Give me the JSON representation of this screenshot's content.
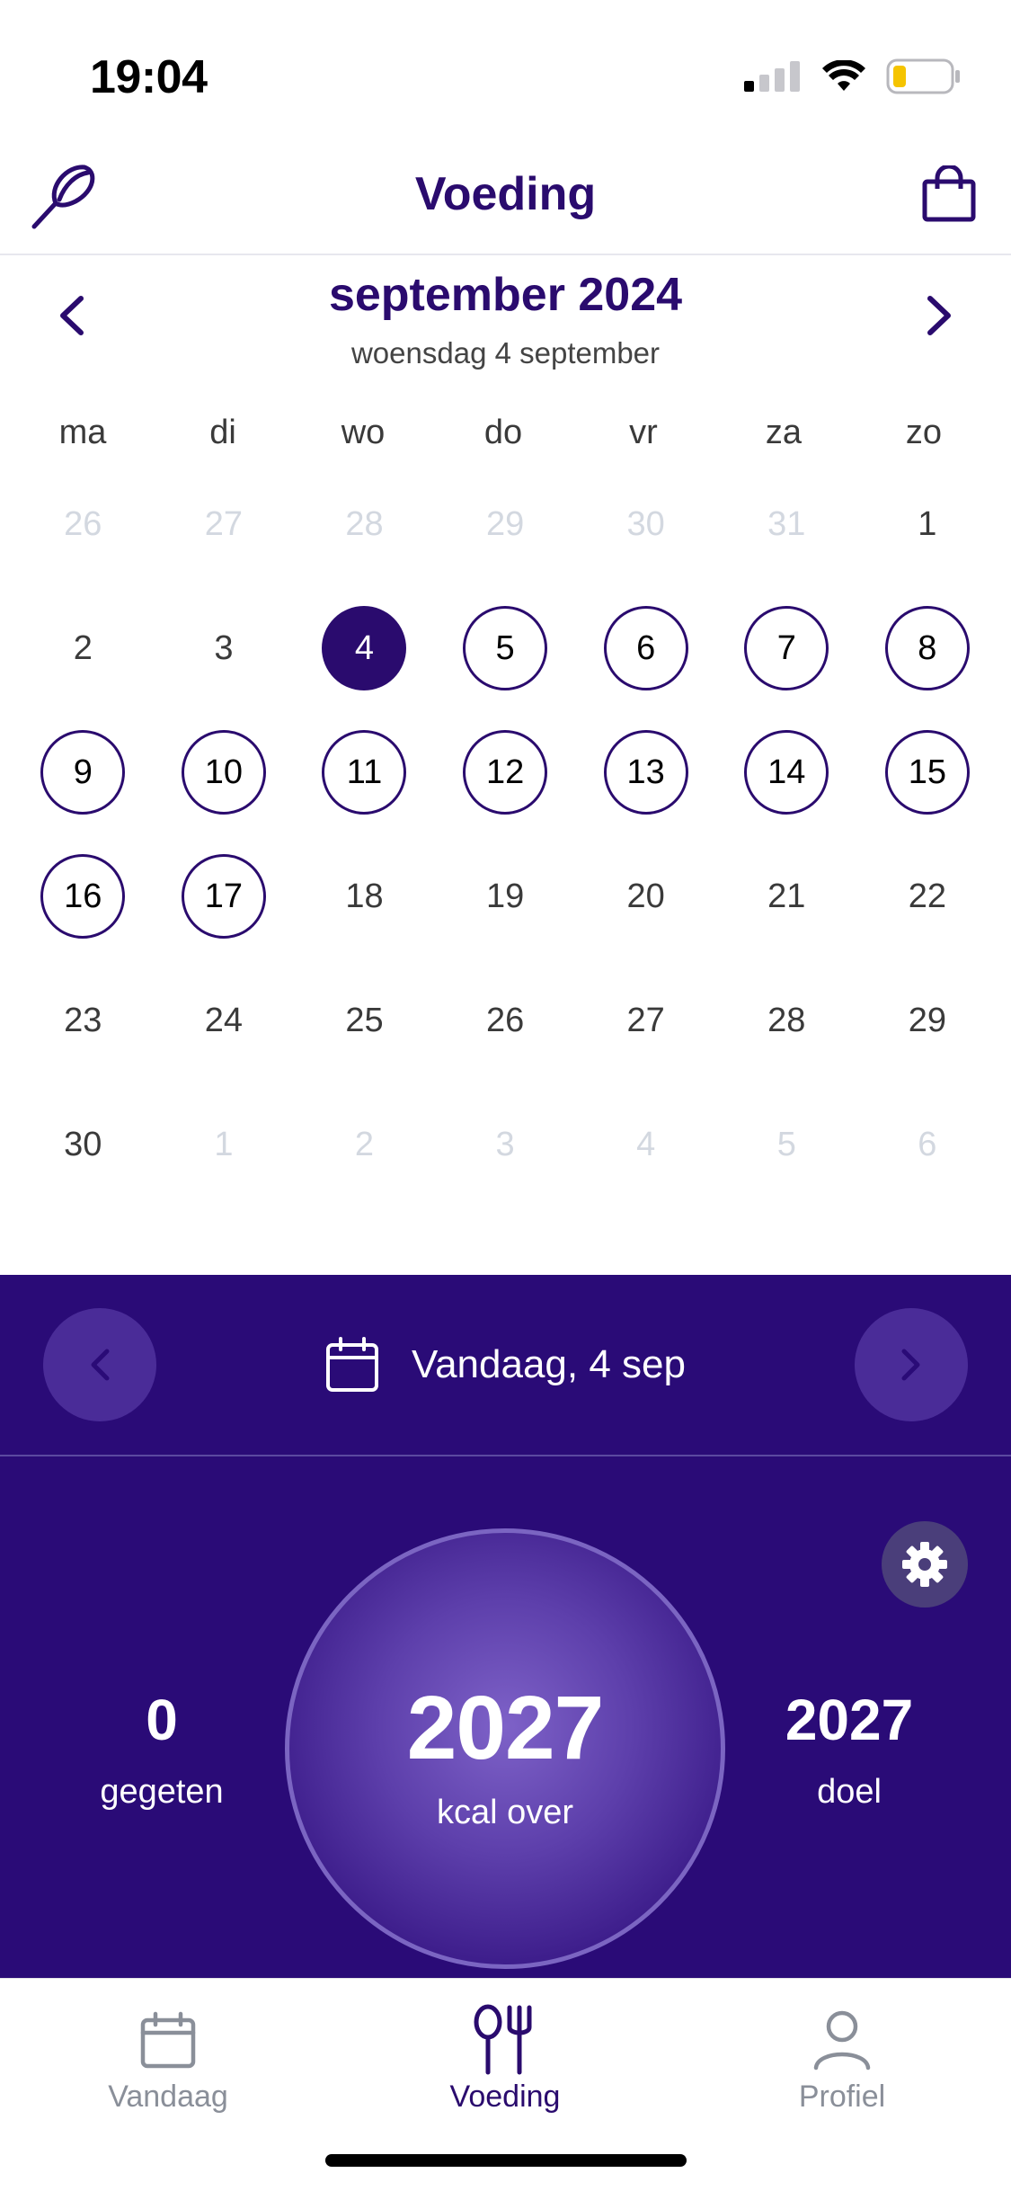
{
  "status": {
    "time": "19:04"
  },
  "header": {
    "title": "Voeding"
  },
  "calendar": {
    "month_label": "september 2024",
    "selected_label": "woensdag 4 september",
    "weekdays": [
      "ma",
      "di",
      "wo",
      "do",
      "vr",
      "za",
      "zo"
    ],
    "days": [
      {
        "n": "26",
        "state": "muted"
      },
      {
        "n": "27",
        "state": "muted"
      },
      {
        "n": "28",
        "state": "muted"
      },
      {
        "n": "29",
        "state": "muted"
      },
      {
        "n": "30",
        "state": "muted"
      },
      {
        "n": "31",
        "state": "muted"
      },
      {
        "n": "1",
        "state": "normal"
      },
      {
        "n": "2",
        "state": "normal"
      },
      {
        "n": "3",
        "state": "normal"
      },
      {
        "n": "4",
        "state": "selected"
      },
      {
        "n": "5",
        "state": "logged"
      },
      {
        "n": "6",
        "state": "logged"
      },
      {
        "n": "7",
        "state": "logged"
      },
      {
        "n": "8",
        "state": "logged"
      },
      {
        "n": "9",
        "state": "logged"
      },
      {
        "n": "10",
        "state": "logged"
      },
      {
        "n": "11",
        "state": "logged"
      },
      {
        "n": "12",
        "state": "logged"
      },
      {
        "n": "13",
        "state": "logged"
      },
      {
        "n": "14",
        "state": "logged"
      },
      {
        "n": "15",
        "state": "logged"
      },
      {
        "n": "16",
        "state": "logged"
      },
      {
        "n": "17",
        "state": "logged"
      },
      {
        "n": "18",
        "state": "normal"
      },
      {
        "n": "19",
        "state": "normal"
      },
      {
        "n": "20",
        "state": "normal"
      },
      {
        "n": "21",
        "state": "normal"
      },
      {
        "n": "22",
        "state": "normal"
      },
      {
        "n": "23",
        "state": "normal"
      },
      {
        "n": "24",
        "state": "normal"
      },
      {
        "n": "25",
        "state": "normal"
      },
      {
        "n": "26",
        "state": "normal"
      },
      {
        "n": "27",
        "state": "normal"
      },
      {
        "n": "28",
        "state": "normal"
      },
      {
        "n": "29",
        "state": "normal"
      },
      {
        "n": "30",
        "state": "normal"
      },
      {
        "n": "1",
        "state": "muted"
      },
      {
        "n": "2",
        "state": "muted"
      },
      {
        "n": "3",
        "state": "muted"
      },
      {
        "n": "4",
        "state": "muted"
      },
      {
        "n": "5",
        "state": "muted"
      },
      {
        "n": "6",
        "state": "muted"
      }
    ]
  },
  "daybar": {
    "label": "Vandaag, 4 sep"
  },
  "summary": {
    "eaten_value": "0",
    "eaten_label": "gegeten",
    "remaining_value": "2027",
    "remaining_label": "kcal over",
    "goal_value": "2027",
    "goal_label": "doel"
  },
  "tabs": [
    {
      "label": "Vandaag",
      "icon": "calendar-icon"
    },
    {
      "label": "Voeding",
      "icon": "utensils-icon"
    },
    {
      "label": "Profiel",
      "icon": "person-icon"
    }
  ],
  "colors": {
    "brand": "#2a0b6e",
    "panel": "#2a0b77",
    "muted": "#d3d8e0",
    "battery": "#f5c400"
  }
}
